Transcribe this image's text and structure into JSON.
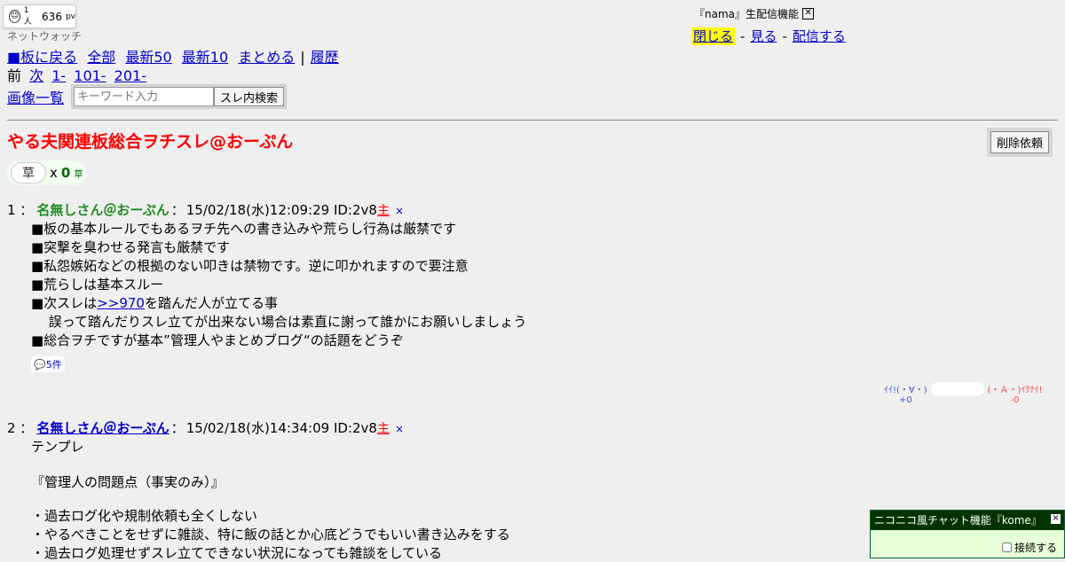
{
  "watch": {
    "people": "1人",
    "pv_count": "636",
    "pv_unit": "pv",
    "label": "ネットウォッチ"
  },
  "nav": {
    "back": "■板に戻る",
    "all": "全部",
    "latest50": "最新50",
    "latest10": "最新10",
    "summarize": "まとめる",
    "sep": "|",
    "history": "履歴",
    "prev": "前",
    "next": "次",
    "range1": "1-",
    "range2": "101-",
    "range3": "201-",
    "images": "画像一覧"
  },
  "search": {
    "placeholder": "キーワード入力",
    "button": "スレ内検索"
  },
  "nama": {
    "title": "『nama』生配信機能",
    "close": "閉じる",
    "watch": "見る",
    "broadcast": "配信する",
    "sep": "-"
  },
  "thread": {
    "title": "やる夫関連板総合ヲチスレ@おーぷん",
    "delete_request": "削除依頼"
  },
  "kusa": {
    "button": "草",
    "x": "x",
    "count": "0",
    "unit": "草"
  },
  "posts": [
    {
      "num": "1 ：",
      "name": "名無しさん＠おーぷん",
      "sep": "：",
      "date": "15/02/18(水)12:09:29 ID:2v8",
      "owner": "主",
      "x": "×",
      "lines": [
        "■板の基本ルールでもあるヲチ先への書き込みや荒らし行為は厳禁です",
        "■突撃を臭わせる発言も厳禁です",
        "■私怨嫉妬などの根拠のない叩きは禁物です。逆に叩かれますので要注意",
        "■荒らしは基本スルー",
        "■次スレは",
        "を踏んだ人が立てる事",
        "　 誤って踏んだりスレ立てが出来ない場合は素直に謝って誰かにお願いしましょう",
        "■総合ヲチですが基本”管理人やまとめブログ“の話題をどうぞ"
      ],
      "anchor": ">>970",
      "replies": "5件"
    },
    {
      "num": "2 ：",
      "name": "名無しさん＠おーぷん",
      "sep": "：",
      "date": "15/02/18(水)14:34:09 ID:2v8",
      "owner": "主",
      "x": "×",
      "lines": [
        "テンプレ",
        "『管理人の問題点（事実のみ）』",
        "・過去ログ化や規制依頼も全くしない",
        "・やるべきことをせずに雑談、特に飯の話とか心底どうでもいい書き込みをする",
        "・過去ログ処理せずスレ立てできない状況になっても雑談をしている"
      ]
    }
  ],
  "vote": {
    "good": "ｲｲ!(・∀・)",
    "good_count": "+0",
    "bad": "(・Ａ・)ｲｸﾅｲ!",
    "bad_count": "-0"
  },
  "chat": {
    "title": "ニコニコ風チャット機能『kome』",
    "close": "×",
    "connect": "接続する"
  }
}
